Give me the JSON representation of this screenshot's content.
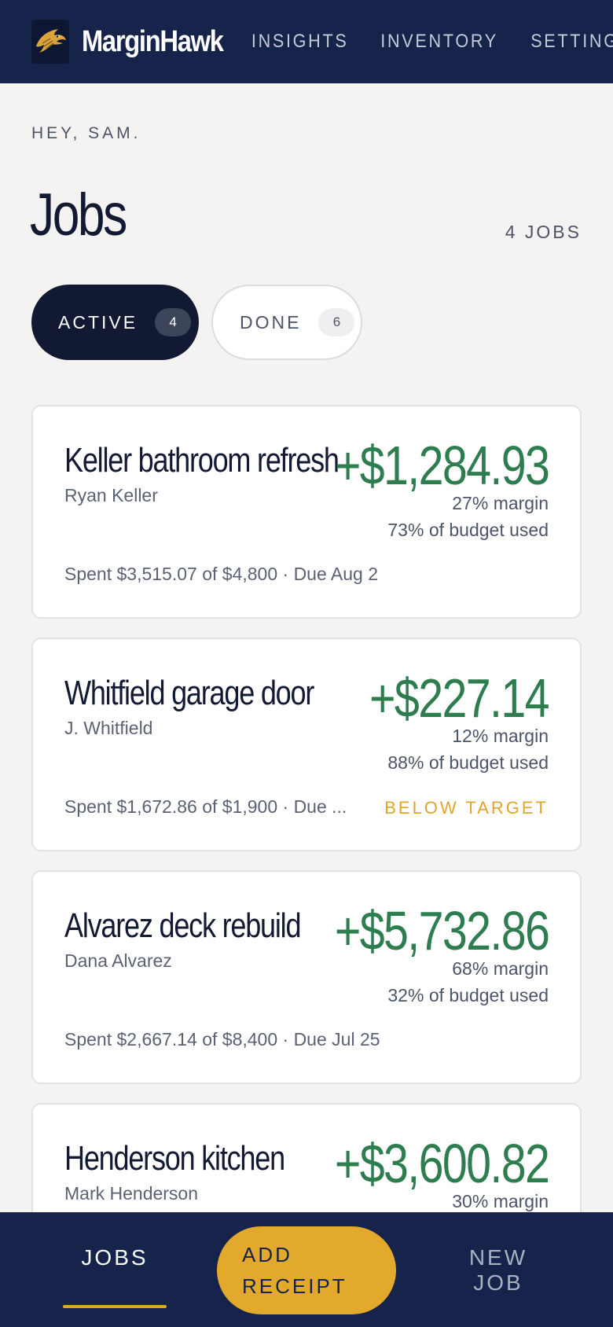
{
  "header": {
    "brand": "MarginHawk",
    "nav": [
      "INSIGHTS",
      "INVENTORY",
      "SETTINGS"
    ]
  },
  "greeting": "HEY, SAM.",
  "page": {
    "title": "Jobs",
    "count_label": "4 JOBS"
  },
  "filters": [
    {
      "label": "ACTIVE",
      "count": "4",
      "selected": true
    },
    {
      "label": "DONE",
      "count": "6",
      "selected": false
    }
  ],
  "jobs": [
    {
      "title": "Keller bathroom refresh",
      "client": "Ryan Keller",
      "profit": "+$1,284.93",
      "margin": "27% margin",
      "budget": "73% of budget used",
      "spent": "Spent $3,515.07 of $4,800 · Due Aug 2",
      "flag": ""
    },
    {
      "title": "Whitfield garage door",
      "client": "J. Whitfield",
      "profit": "+$227.14",
      "margin": "12% margin",
      "budget": "88% of budget used",
      "spent": "Spent $1,672.86 of $1,900 · Due ...",
      "flag": "BELOW TARGET"
    },
    {
      "title": "Alvarez deck rebuild",
      "client": "Dana Alvarez",
      "profit": "+$5,732.86",
      "margin": "68% margin",
      "budget": "32% of budget used",
      "spent": "Spent $2,667.14 of $8,400 · Due Jul 25",
      "flag": ""
    },
    {
      "title": "Henderson kitchen",
      "client": "Mark Henderson",
      "profit": "+$3,600.82",
      "margin": "30% margin",
      "budget": "",
      "spent": "",
      "flag": ""
    }
  ],
  "bottom_nav": {
    "jobs": "JOBS",
    "add_receipt": "ADD RECEIPT",
    "new_job": "NEW JOB"
  },
  "colors": {
    "header_bg": "#16234a",
    "accent": "#e3a92c",
    "profit_green": "#2e7d4f"
  },
  "icons": {
    "logo": "hawk-logo-icon"
  }
}
